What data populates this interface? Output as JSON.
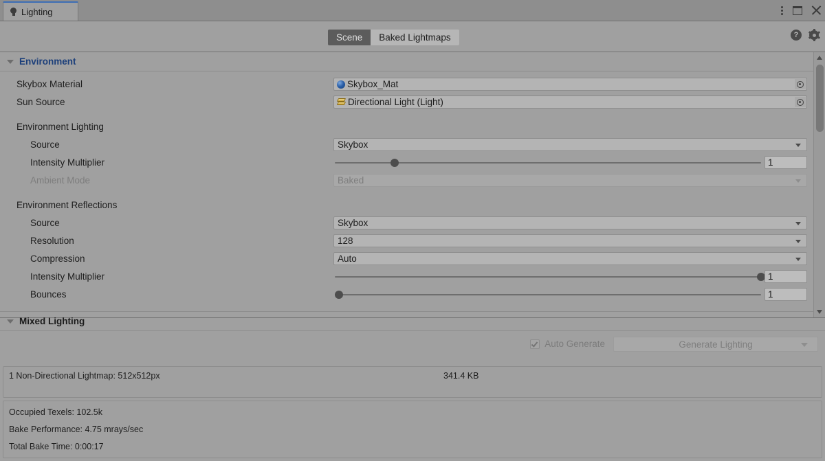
{
  "window": {
    "tab_label": "Lighting",
    "tab_icon": "lightbulb-icon",
    "menu_icon": "kebab-menu-icon",
    "maximize_icon": "maximize-icon",
    "close_icon": "close-icon"
  },
  "toolbar": {
    "tabs": [
      {
        "label": "Scene",
        "active": true
      },
      {
        "label": "Baked Lightmaps",
        "active": false
      }
    ],
    "help_icon": "?",
    "settings_icon": "gear-icon"
  },
  "environment": {
    "section_title": "Environment",
    "skybox_material": {
      "label": "Skybox Material",
      "value": "Skybox_Mat"
    },
    "sun_source": {
      "label": "Sun Source",
      "value": "Directional Light (Light)"
    },
    "lighting_group": {
      "label": "Environment Lighting",
      "source": {
        "label": "Source",
        "value": "Skybox"
      },
      "intensity_multiplier": {
        "label": "Intensity Multiplier",
        "value": "1",
        "slider_percent": 14
      },
      "ambient_mode": {
        "label": "Ambient Mode",
        "value": "Baked",
        "disabled": true
      }
    },
    "reflections_group": {
      "label": "Environment Reflections",
      "source": {
        "label": "Source",
        "value": "Skybox"
      },
      "resolution": {
        "label": "Resolution",
        "value": "128"
      },
      "compression": {
        "label": "Compression",
        "value": "Auto"
      },
      "intensity_multiplier": {
        "label": "Intensity Multiplier",
        "value": "1",
        "slider_percent": 100
      },
      "bounces": {
        "label": "Bounces",
        "value": "1",
        "slider_percent": 1
      }
    }
  },
  "mixed_lighting": {
    "section_title": "Mixed Lighting"
  },
  "generate": {
    "auto_generate_label": "Auto Generate",
    "auto_generate_checked": true,
    "generate_button_label": "Generate Lighting"
  },
  "stats": {
    "lightmap_line": "1 Non-Directional Lightmap: 512x512px",
    "lightmap_size": "341.4 KB",
    "occupied_texels": "Occupied Texels: 102.5k",
    "bake_performance": "Bake Performance: 4.75 mrays/sec",
    "total_bake_time": "Total Bake Time: 0:00:17"
  },
  "colors": {
    "accent_tab": "#3d6eb5",
    "section_header": "#1c3f7a",
    "panel_bg": "#a0a0a0",
    "field_bg": "#b4b4b4"
  }
}
